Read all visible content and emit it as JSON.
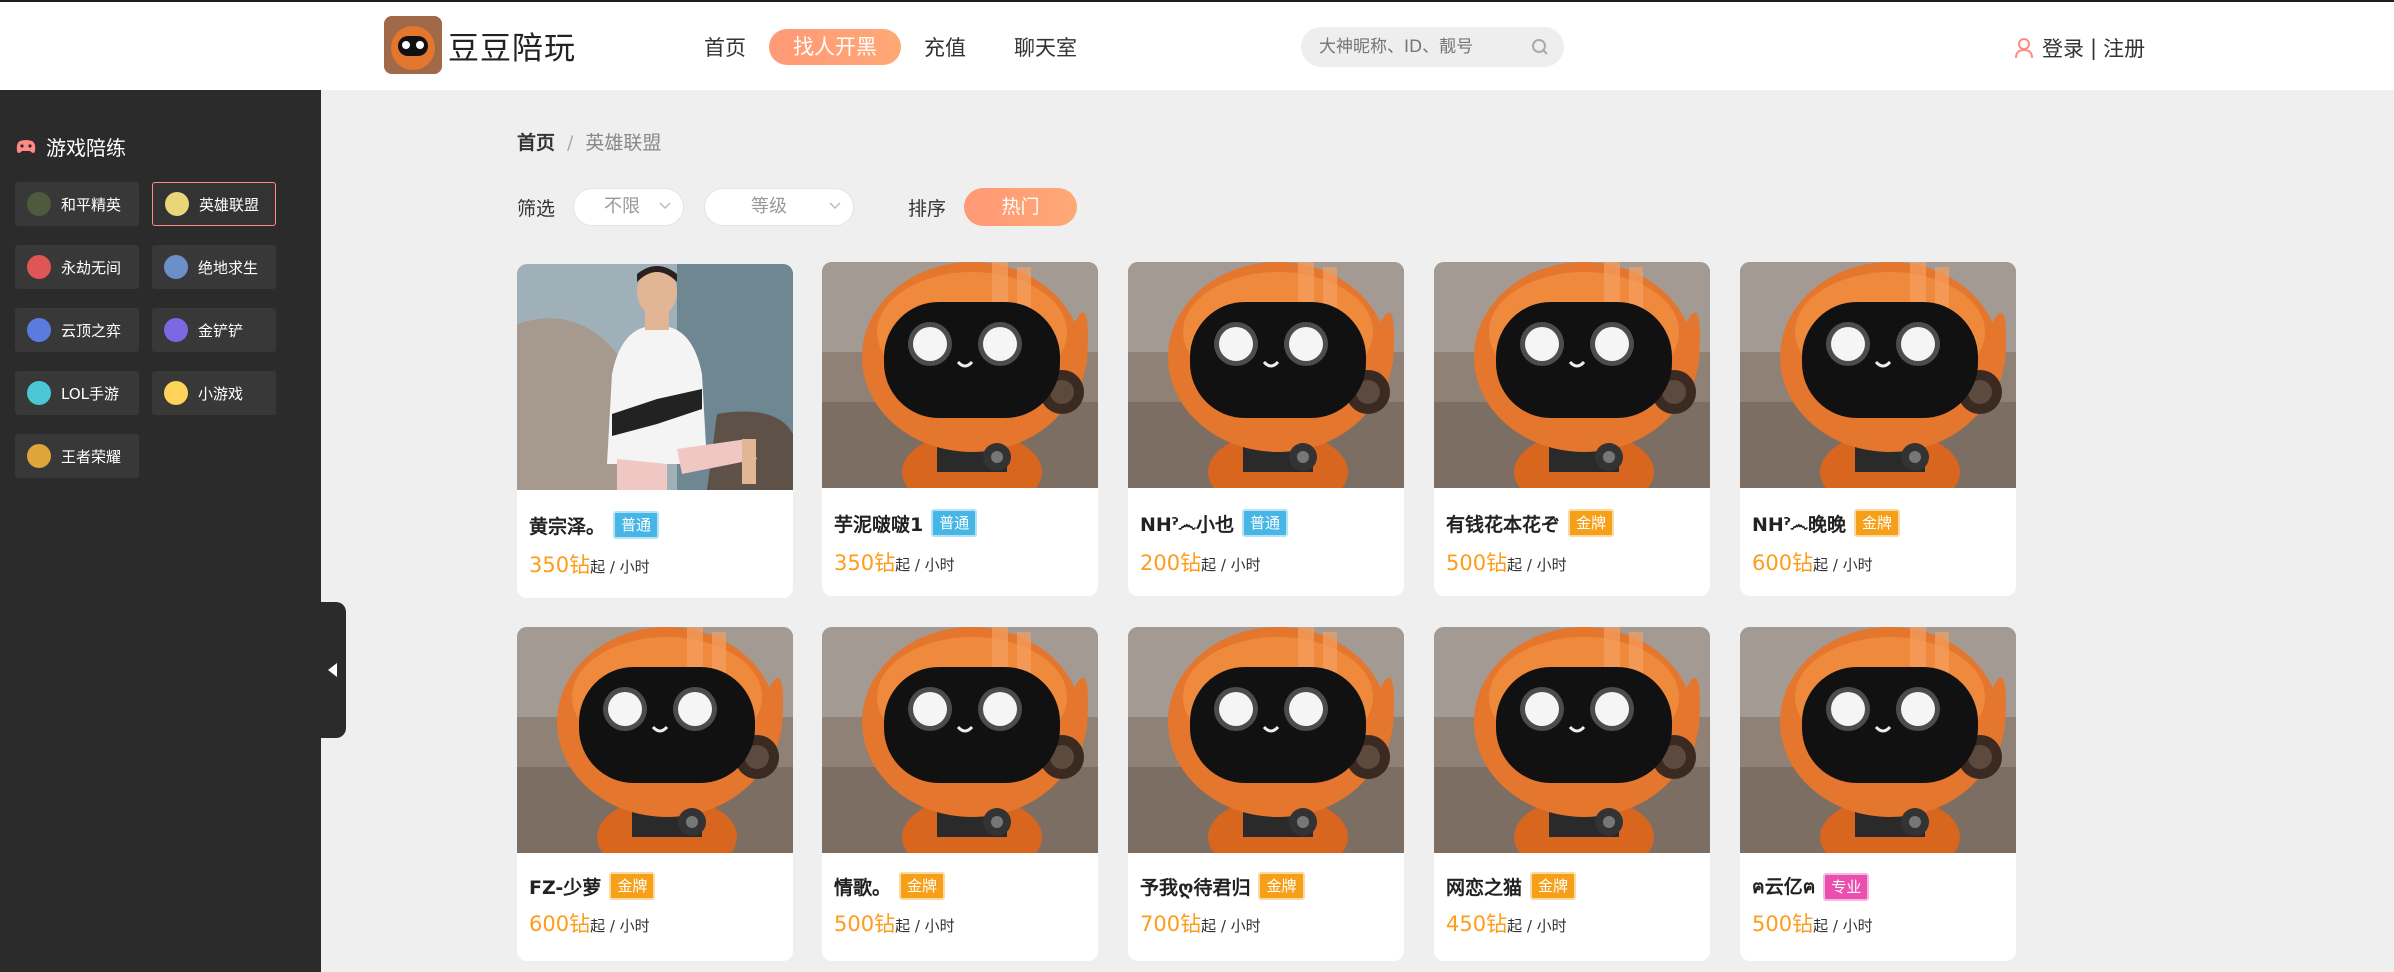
{
  "header": {
    "logo_text": "豆豆陪玩",
    "nav": [
      "首页",
      "找人开黑",
      "充值",
      "聊天室"
    ],
    "active_nav": "找人开黑",
    "search_placeholder": "大神昵称、ID、靓号",
    "login": "登录",
    "separator": "|",
    "register": "注册"
  },
  "sidebar": {
    "title": "游戏陪练",
    "games": [
      {
        "label": "和平精英",
        "icon": "pubg-mobile-icon",
        "color": "#4e5a3e"
      },
      {
        "label": "英雄联盟",
        "icon": "league-of-legends-icon",
        "color": "#e8d77a",
        "active": true
      },
      {
        "label": "永劫无间",
        "icon": "naraka-icon",
        "color": "#e05555"
      },
      {
        "label": "绝地求生",
        "icon": "pubg-icon",
        "color": "#6a8fc9"
      },
      {
        "label": "云顶之弈",
        "icon": "tft-icon",
        "color": "#5b7be0"
      },
      {
        "label": "金铲铲",
        "icon": "golden-spatula-icon",
        "color": "#7a69e3"
      },
      {
        "label": "LOL手游",
        "icon": "wild-rift-icon",
        "color": "#4cc7d6"
      },
      {
        "label": "小游戏",
        "icon": "mini-game-icon",
        "color": "#ffd35a"
      },
      {
        "label": "王者荣耀",
        "icon": "honor-of-kings-icon",
        "color": "#e0a53a"
      }
    ]
  },
  "breadcrumb": {
    "home": "首页",
    "separator": "/",
    "current": "英雄联盟"
  },
  "filters": {
    "label": "筛选",
    "select1": "不限",
    "select2": "等级",
    "sort_label": "排序",
    "sort_value": "热门"
  },
  "price_unit": "钻",
  "price_suffix": "起 / 小时",
  "cards": [
    {
      "name": "黄宗泽。",
      "badge": "普通",
      "level": "normal",
      "price": "350",
      "photo": "person"
    },
    {
      "name": "芋泥啵啵1",
      "badge": "普通",
      "level": "normal",
      "price": "350",
      "photo": "robot"
    },
    {
      "name": "NHˀ෴小也",
      "badge": "普通",
      "level": "normal",
      "price": "200",
      "photo": "robot"
    },
    {
      "name": "有钱花本花ぞ",
      "badge": "金牌",
      "level": "gold",
      "price": "500",
      "photo": "robot"
    },
    {
      "name": "NHˀ෴晚晚",
      "badge": "金牌",
      "level": "gold",
      "price": "600",
      "photo": "robot"
    },
    {
      "name": "FZ-少萝",
      "badge": "金牌",
      "level": "gold",
      "price": "600",
      "photo": "robot"
    },
    {
      "name": "情歌。",
      "badge": "金牌",
      "level": "gold",
      "price": "500",
      "photo": "robot"
    },
    {
      "name": "予我ღ待君归",
      "badge": "金牌",
      "level": "gold",
      "price": "700",
      "photo": "robot"
    },
    {
      "name": "网恋之猫",
      "badge": "金牌",
      "level": "gold",
      "price": "450",
      "photo": "robot"
    },
    {
      "name": "ฅ云亿ฅ",
      "badge": "专业",
      "level": "pro",
      "price": "500",
      "photo": "robot"
    }
  ]
}
